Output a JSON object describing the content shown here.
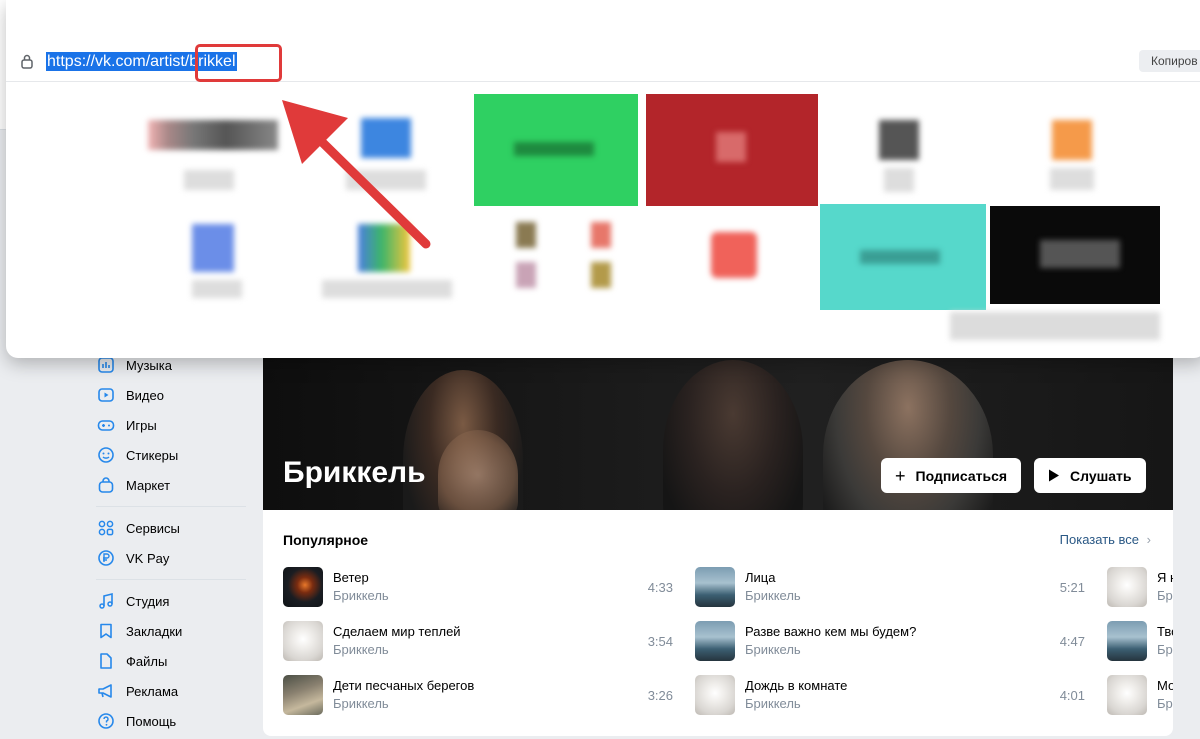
{
  "browser": {
    "url": "https://vk.com/artist/brikkel",
    "copy_label": "Копиров"
  },
  "sidebar": {
    "items": [
      {
        "label": "Музыка",
        "icon": "music-icon"
      },
      {
        "label": "Видео",
        "icon": "video-icon"
      },
      {
        "label": "Игры",
        "icon": "gamepad-icon"
      },
      {
        "label": "Стикеры",
        "icon": "smile-icon"
      },
      {
        "label": "Маркет",
        "icon": "bag-icon"
      },
      {
        "label": "Сервисы",
        "icon": "grid-icon"
      },
      {
        "label": "VK Pay",
        "icon": "ruble-icon"
      },
      {
        "label": "Студия",
        "icon": "note-icon"
      },
      {
        "label": "Закладки",
        "icon": "bookmark-icon"
      },
      {
        "label": "Файлы",
        "icon": "file-icon"
      },
      {
        "label": "Реклама",
        "icon": "megaphone-icon"
      },
      {
        "label": "Помощь",
        "icon": "help-icon"
      }
    ]
  },
  "artist": {
    "name": "Бриккель",
    "subscribe_label": "Подписаться",
    "listen_label": "Слушать"
  },
  "popular": {
    "title": "Популярное",
    "show_all": "Показать все",
    "tracks": [
      {
        "title": "Ветер",
        "artist": "Бриккель",
        "duration": "4:33"
      },
      {
        "title": "Сделаем мир теплей",
        "artist": "Бриккель",
        "duration": "3:54"
      },
      {
        "title": "Дети песчаных берегов",
        "artist": "Бриккель",
        "duration": "3:26"
      },
      {
        "title": "Лица",
        "artist": "Бриккель",
        "duration": "5:21"
      },
      {
        "title": "Разве важно кем мы будем?",
        "artist": "Бриккель",
        "duration": "4:47"
      },
      {
        "title": "Дождь в комнате",
        "artist": "Бриккель",
        "duration": "4:01"
      },
      {
        "title": "Я н",
        "artist": "Бр",
        "duration": ""
      },
      {
        "title": "Тво",
        "artist": "Бр",
        "duration": ""
      },
      {
        "title": "Мо",
        "artist": "Бр",
        "duration": ""
      }
    ]
  },
  "colors": {
    "accent": "#2688eb",
    "highlight_red": "#e03a3a",
    "url_selection": "#1a73e8"
  }
}
